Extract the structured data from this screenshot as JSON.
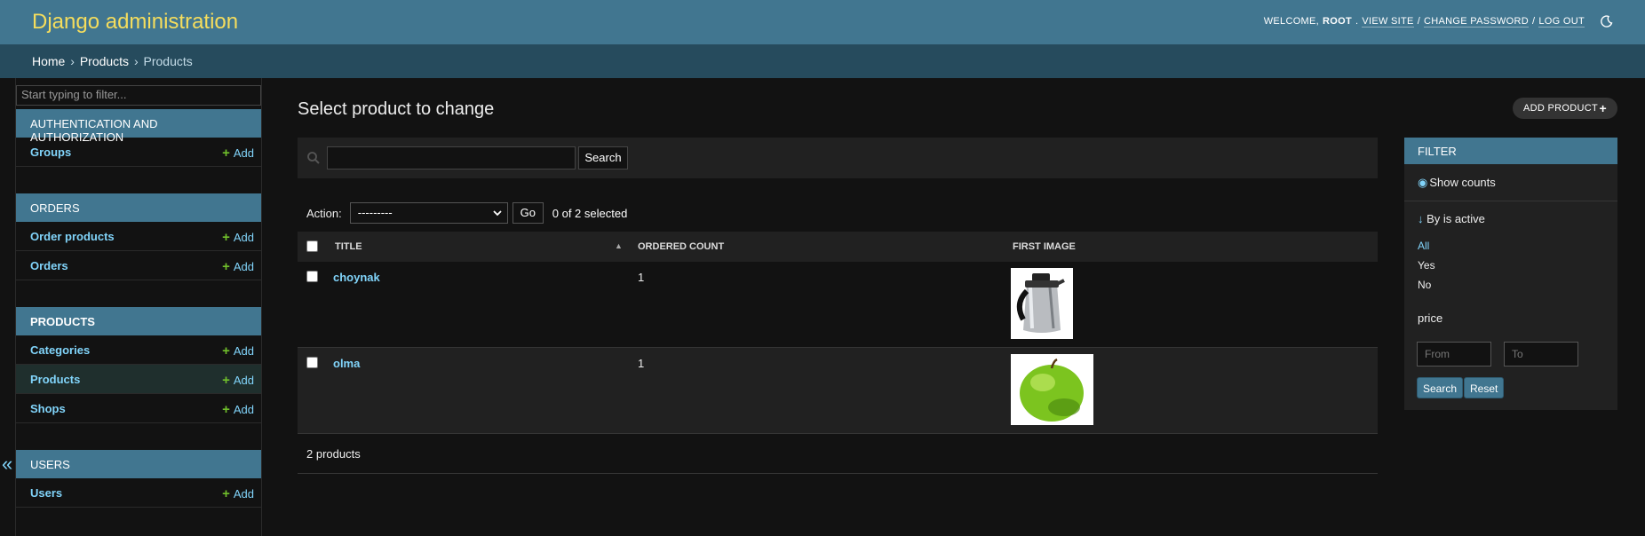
{
  "header": {
    "branding": "Django administration",
    "welcome": "Welcome,",
    "username": "root",
    "view_site": "View site",
    "change_password": "Change password",
    "log_out": "Log out",
    "sep": "/"
  },
  "breadcrumbs": {
    "home": "Home",
    "app": "Products",
    "current": "Products",
    "sep": "›"
  },
  "sidebar": {
    "filter_placeholder": "Start typing to filter...",
    "add_label": "Add",
    "modules": [
      {
        "caption": "Authentication and Authorization",
        "models": [
          "Groups"
        ]
      },
      {
        "caption": "Orders",
        "models": [
          "Order products",
          "Orders"
        ]
      },
      {
        "caption": "Products",
        "models": [
          "Categories",
          "Products",
          "Shops"
        ]
      },
      {
        "caption": "Users",
        "models": [
          "Users"
        ]
      }
    ],
    "collapse_glyph": "«"
  },
  "content": {
    "title": "Select product to change",
    "add_button": "Add product",
    "search_button": "Search",
    "action_label": "Action:",
    "action_value": "---------",
    "go_button": "Go",
    "selection_counter": "0 of 2 selected"
  },
  "table": {
    "columns": [
      "Title",
      "Ordered count",
      "First image"
    ],
    "rows": [
      {
        "title": "choynak",
        "ordered_count": "1",
        "image": "kettle"
      },
      {
        "title": "olma",
        "ordered_count": "1",
        "image": "green-apple"
      }
    ],
    "paginator": "2 products"
  },
  "filter": {
    "title": "Filter",
    "show_counts": "Show counts",
    "by_active_heading": "By is active",
    "choices": [
      "All",
      "Yes",
      "No"
    ],
    "selected_choice": "All",
    "price_heading": "price",
    "from_placeholder": "From",
    "to_placeholder": "To",
    "search_button": "Search",
    "reset_button": "Reset"
  },
  "colors": {
    "header_bg": "#417690",
    "branding": "#f5dd5d",
    "link": "#81d4fa",
    "add_plus": "#70bf2b",
    "background": "#121212"
  }
}
